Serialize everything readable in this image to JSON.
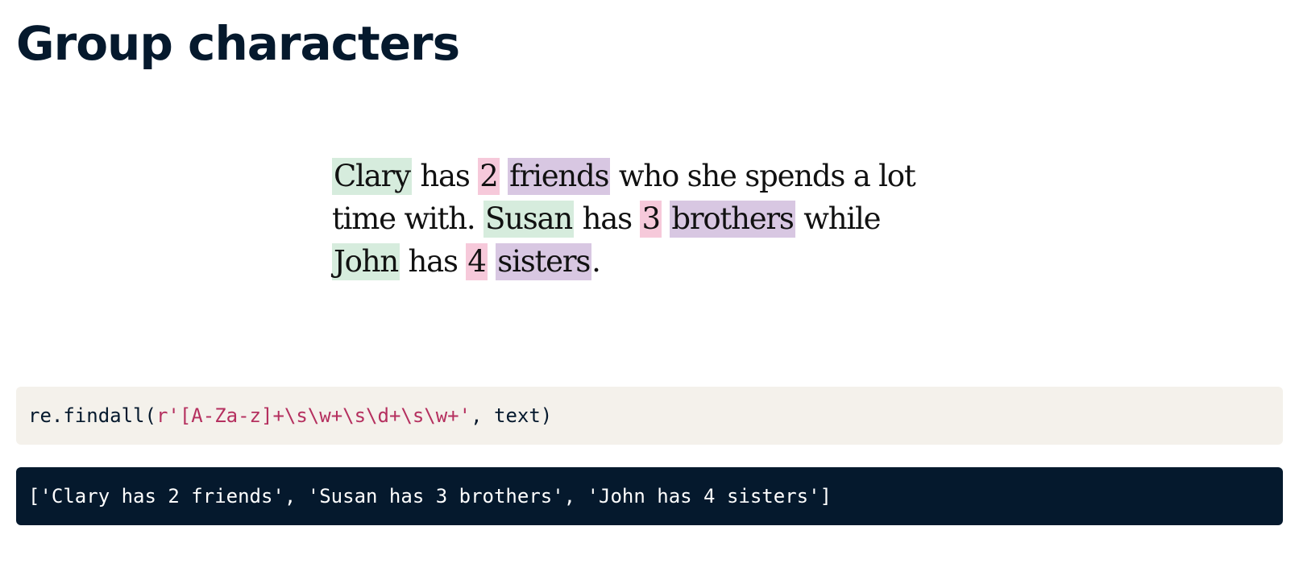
{
  "page": {
    "title": "Group characters"
  },
  "illustration": {
    "lines": [
      [
        {
          "text": "Clary",
          "highlight": "name"
        },
        {
          "text": " has ",
          "highlight": null
        },
        {
          "text": "2",
          "highlight": "num"
        },
        {
          "text": " ",
          "highlight": null
        },
        {
          "text": "friends",
          "highlight": "noun"
        },
        {
          "text": " who she spends a lot",
          "highlight": null
        }
      ],
      [
        {
          "text": "time with. ",
          "highlight": null
        },
        {
          "text": "Susan",
          "highlight": "name"
        },
        {
          "text": " has ",
          "highlight": null
        },
        {
          "text": "3",
          "highlight": "num"
        },
        {
          "text": " ",
          "highlight": null
        },
        {
          "text": "brothers",
          "highlight": "noun"
        },
        {
          "text": " while",
          "highlight": null
        }
      ],
      [
        {
          "text": "John",
          "highlight": "name"
        },
        {
          "text": " has ",
          "highlight": null
        },
        {
          "text": "4",
          "highlight": "num"
        },
        {
          "text": " ",
          "highlight": null
        },
        {
          "text": "sisters",
          "highlight": "noun"
        },
        {
          "text": ".",
          "highlight": null
        }
      ]
    ],
    "highlight_colors": {
      "name": "#d6ecdd",
      "num": "#f6c9da",
      "noun": "#d8c7e2"
    }
  },
  "code": {
    "prefix": "re.findall(",
    "pattern": "r'[A-Za-z]+\\s\\w+\\s\\d+\\s\\w+'",
    "suffix": ", text)",
    "background": "#f4f1eb",
    "string_color": "#b5305f"
  },
  "output": {
    "text": "['Clary has 2 friends', 'Susan has 3 brothers', 'John has 4 sisters']",
    "background": "#05192d"
  }
}
